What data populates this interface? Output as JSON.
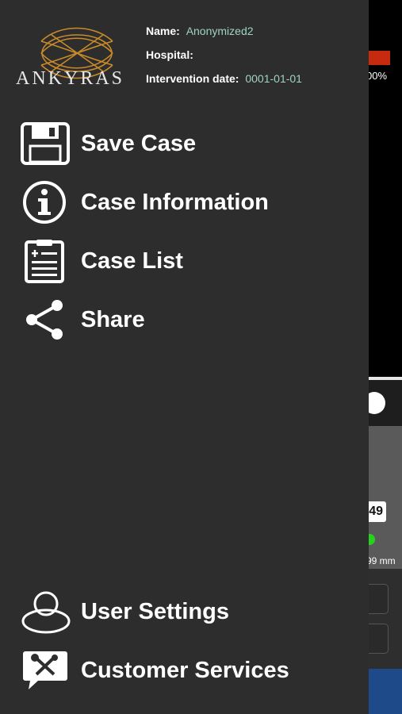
{
  "background": {
    "progress_label": "00%",
    "tag_value": "49",
    "measure_label": "99 mm"
  },
  "case": {
    "name_label": "Name:",
    "name_value": "Anonymized2",
    "hospital_label": "Hospital:",
    "hospital_value": "",
    "date_label": "Intervention date:",
    "date_value": "0001-01-01"
  },
  "brand": "ANKYRAS",
  "menu": {
    "save_case": "Save Case",
    "case_information": "Case Information",
    "case_list": "Case List",
    "share": "Share",
    "user_settings": "User Settings",
    "customer_services": "Customer Services"
  },
  "colors": {
    "drawer_bg": "#2d2d2d",
    "accent_value": "#9fd3c6",
    "logo_gold": "#c98a2a"
  },
  "icons": {
    "save_case": "floppy-disk-icon",
    "case_information": "info-icon",
    "case_list": "clipboard-icon",
    "share": "share-icon",
    "user_settings": "user-icon",
    "customer_services": "tools-chat-icon"
  }
}
